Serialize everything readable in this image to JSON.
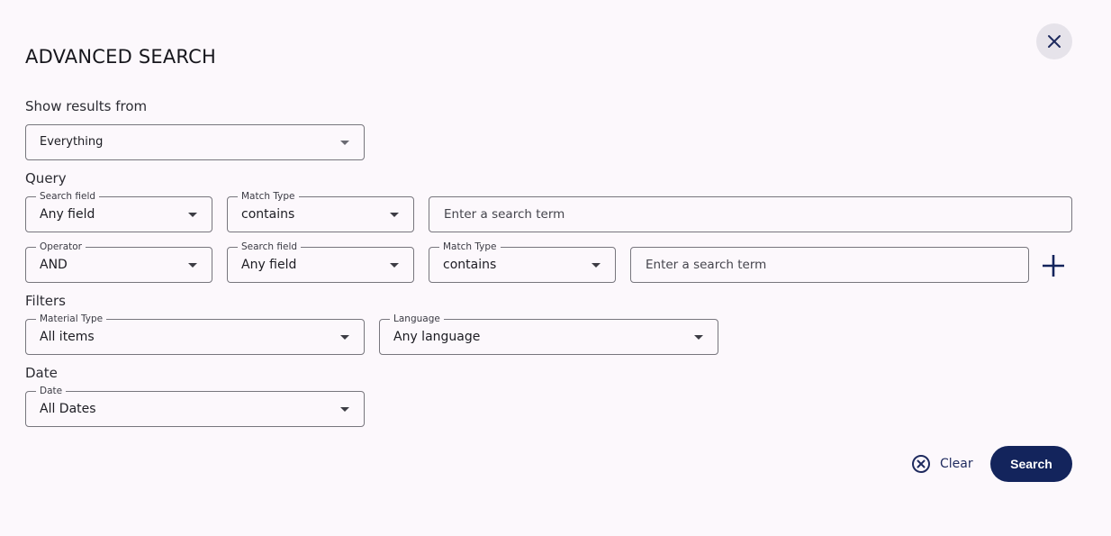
{
  "dialog": {
    "title": "ADVANCED SEARCH",
    "close_icon": "close-icon"
  },
  "show_results": {
    "label": "Show results from",
    "value": "Everything"
  },
  "query": {
    "label": "Query",
    "row1": {
      "search_field": {
        "legend": "Search field",
        "value": "Any field"
      },
      "match_type": {
        "legend": "Match Type",
        "value": "contains"
      },
      "term_placeholder": "Enter a search term"
    },
    "row2": {
      "operator": {
        "legend": "Operator",
        "value": "AND"
      },
      "search_field": {
        "legend": "Search field",
        "value": "Any field"
      },
      "match_type": {
        "legend": "Match Type",
        "value": "contains"
      },
      "term_placeholder": "Enter a search term"
    },
    "add_icon": "plus-icon"
  },
  "filters": {
    "label": "Filters",
    "material_type": {
      "legend": "Material Type",
      "value": "All items"
    },
    "language": {
      "legend": "Language",
      "value": "Any language"
    }
  },
  "date": {
    "label": "Date",
    "date_field": {
      "legend": "Date",
      "value": "All Dates"
    }
  },
  "actions": {
    "clear_label": "Clear",
    "search_label": "Search"
  },
  "colors": {
    "background": "#fcf8fc",
    "primary": "#13245c",
    "border": "#77767d"
  }
}
